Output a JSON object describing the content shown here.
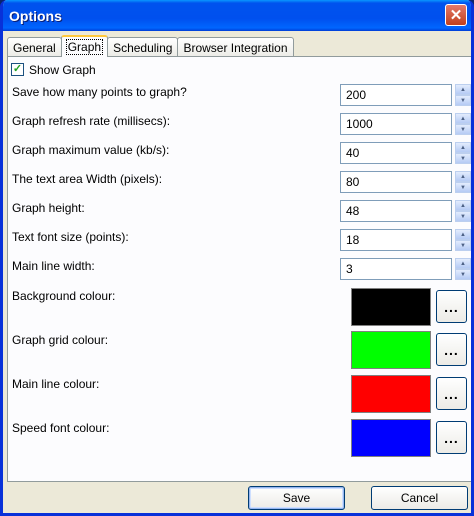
{
  "window": {
    "title": "Options",
    "close_label": "✕"
  },
  "tabs": [
    {
      "label": "General"
    },
    {
      "label": "Graph"
    },
    {
      "label": "Scheduling"
    },
    {
      "label": "Browser Integration"
    }
  ],
  "graph": {
    "show_graph_label": "Show Graph",
    "show_graph_checked": true,
    "fields": [
      {
        "label": "Save how many points to graph?",
        "value": "200"
      },
      {
        "label": "Graph refresh rate (millisecs):",
        "value": "1000"
      },
      {
        "label": "Graph maximum value (kb/s):",
        "value": "40"
      },
      {
        "label": "The text area Width (pixels):",
        "value": "80"
      },
      {
        "label": "Graph height:",
        "value": "48"
      },
      {
        "label": "Text font size (points):",
        "value": "18"
      },
      {
        "label": "Main line width:",
        "value": "3"
      }
    ],
    "colors": [
      {
        "label": "Background colour:",
        "color": "#000000"
      },
      {
        "label": "Graph grid colour:",
        "color": "#00ff00"
      },
      {
        "label": "Main line colour:",
        "color": "#ff0000"
      },
      {
        "label": "Speed font colour:",
        "color": "#0000ff"
      }
    ],
    "picker_label": "..."
  },
  "buttons": {
    "save": "Save",
    "cancel": "Cancel"
  }
}
